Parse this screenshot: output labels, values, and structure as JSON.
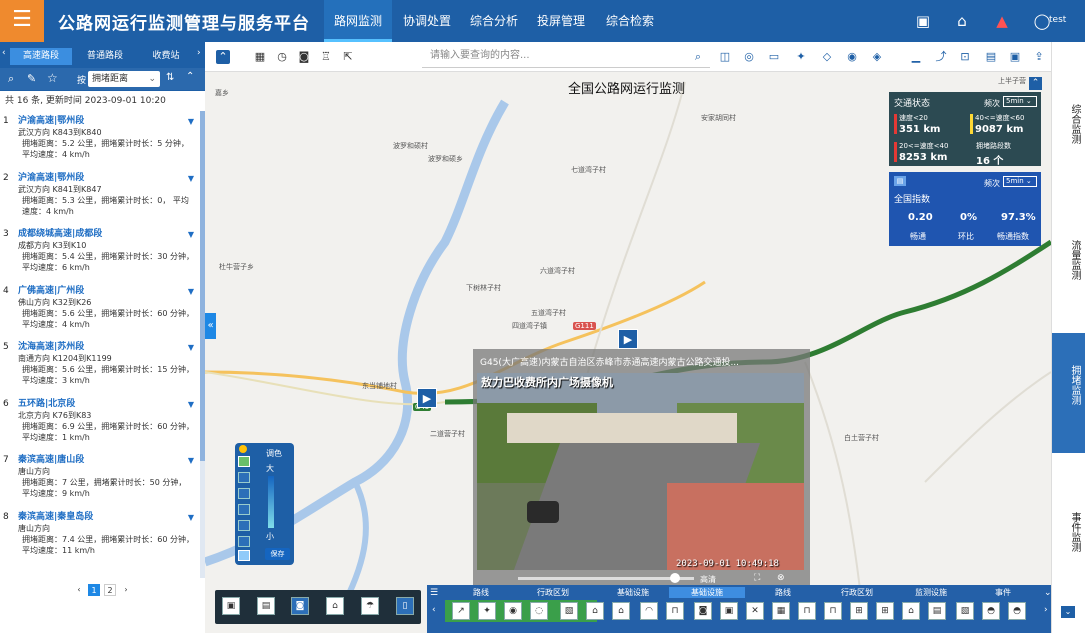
{
  "header": {
    "title": "公路网运行监测管理与服务平台",
    "nav": [
      "路网监测",
      "协调处置",
      "综合分析",
      "投屏管理",
      "综合检索"
    ],
    "active_nav": 0,
    "user": "test"
  },
  "left_panel": {
    "tabs": [
      "高速路段",
      "普通路段",
      "收费站"
    ],
    "active_tab": 0,
    "sort_label": "按",
    "sort_value": "拥堵距离",
    "summary": "共 16 条, 更新时间 2023-09-01 10:20",
    "items": [
      {
        "num": "1",
        "name": "沪渝高速|鄂州段",
        "dir": "武汉方向  K843到K840",
        "detail": "拥堵距离：5.2 公里，拥堵累计时长：5 分钟， 平均速度：4 km/h"
      },
      {
        "num": "2",
        "name": "沪渝高速|鄂州段",
        "dir": "武汉方向  K841到K847",
        "detail": "拥堵距离：5.3 公里，拥堵累计时长：0， 平均速度：4 km/h"
      },
      {
        "num": "3",
        "name": "成都绕城高速|成都段",
        "dir": "成都方向  K3到K10",
        "detail": "拥堵距离：5.4 公里，拥堵累计时长：30 分钟， 平均速度：6 km/h"
      },
      {
        "num": "4",
        "name": "广佛高速|广州段",
        "dir": "佛山方向  K32到K26",
        "detail": "拥堵距离：5.6 公里，拥堵累计时长：60 分钟， 平均速度：4 km/h"
      },
      {
        "num": "5",
        "name": "沈海高速|苏州段",
        "dir": "南通方向  K1204到K1199",
        "detail": "拥堵距离：5.6 公里，拥堵累计时长：15 分钟， 平均速度：3 km/h"
      },
      {
        "num": "6",
        "name": "五环路|北京段",
        "dir": "北京方向  K76到K83",
        "detail": "拥堵距离：6.9 公里，拥堵累计时长：60 分钟， 平均速度：1 km/h"
      },
      {
        "num": "7",
        "name": "秦滨高速|唐山段",
        "dir": "唐山方向",
        "detail": "拥堵距离：7 公里，拥堵累计时长：50 分钟， 平均速度：9 km/h"
      },
      {
        "num": "8",
        "name": "秦滨高速|秦皇岛段",
        "dir": "唐山方向",
        "detail": "拥堵距离：7.4 公里，拥堵累计时长：60 分钟， 平均速度：11 km/h"
      }
    ],
    "pages": [
      "1",
      "2"
    ]
  },
  "map": {
    "search_placeholder": "请输入要查询的内容...",
    "title": "全国公路网运行监测",
    "places": [
      "波罗和硕村",
      "波罗和硕乡",
      "七道湾子村",
      "安家胡同村",
      "下树林子村",
      "六道湾子村",
      "五道湾子村",
      "四道湾子镇",
      "杜牛营子乡",
      "东当铺地村",
      "二道营子村",
      "白土营子村",
      "上半子营",
      "G111",
      "G45",
      "十",
      "嘉乡"
    ]
  },
  "traffic_status": {
    "title": "交通状态",
    "freq_label": "频次",
    "freq": "5min",
    "cells": [
      {
        "label": "速度<20",
        "value": "351 km",
        "color": "#e53935"
      },
      {
        "label": "40<=速度<60",
        "value": "9087 km",
        "color": "#fdd835"
      },
      {
        "label": "20<=速度<40",
        "value": "8253 km",
        "color": "#e53935"
      },
      {
        "label": "拥堵路段数",
        "value": "16 个",
        "color": ""
      }
    ]
  },
  "national_index": {
    "title": "全国指数",
    "freq_label": "频次",
    "freq": "5min",
    "stats": [
      {
        "value": "0.20",
        "label": "畅通"
      },
      {
        "value": "0%",
        "label": "环比"
      },
      {
        "value": "97.3%",
        "label": "畅通指数"
      }
    ]
  },
  "right_tabs": [
    "综合监测",
    "流量监测",
    "拥堵监测",
    "事件监测"
  ],
  "active_right_tab": 2,
  "video": {
    "title": "G45(大广高速)内蒙古自治区赤峰市赤通高速内蒙古公路交通投...",
    "caption": "敖力巴收费所内广场摄像机",
    "timestamp": "2023-09-01  10:49:18",
    "quality": "高清"
  },
  "legend": {
    "title": "调色",
    "big": "大",
    "small": "小",
    "save": "保存"
  },
  "bottom_tabs": [
    "路线",
    "行政区划",
    "基础设施",
    "基础设施",
    "路线",
    "行政区划",
    "监测设施",
    "事件"
  ]
}
